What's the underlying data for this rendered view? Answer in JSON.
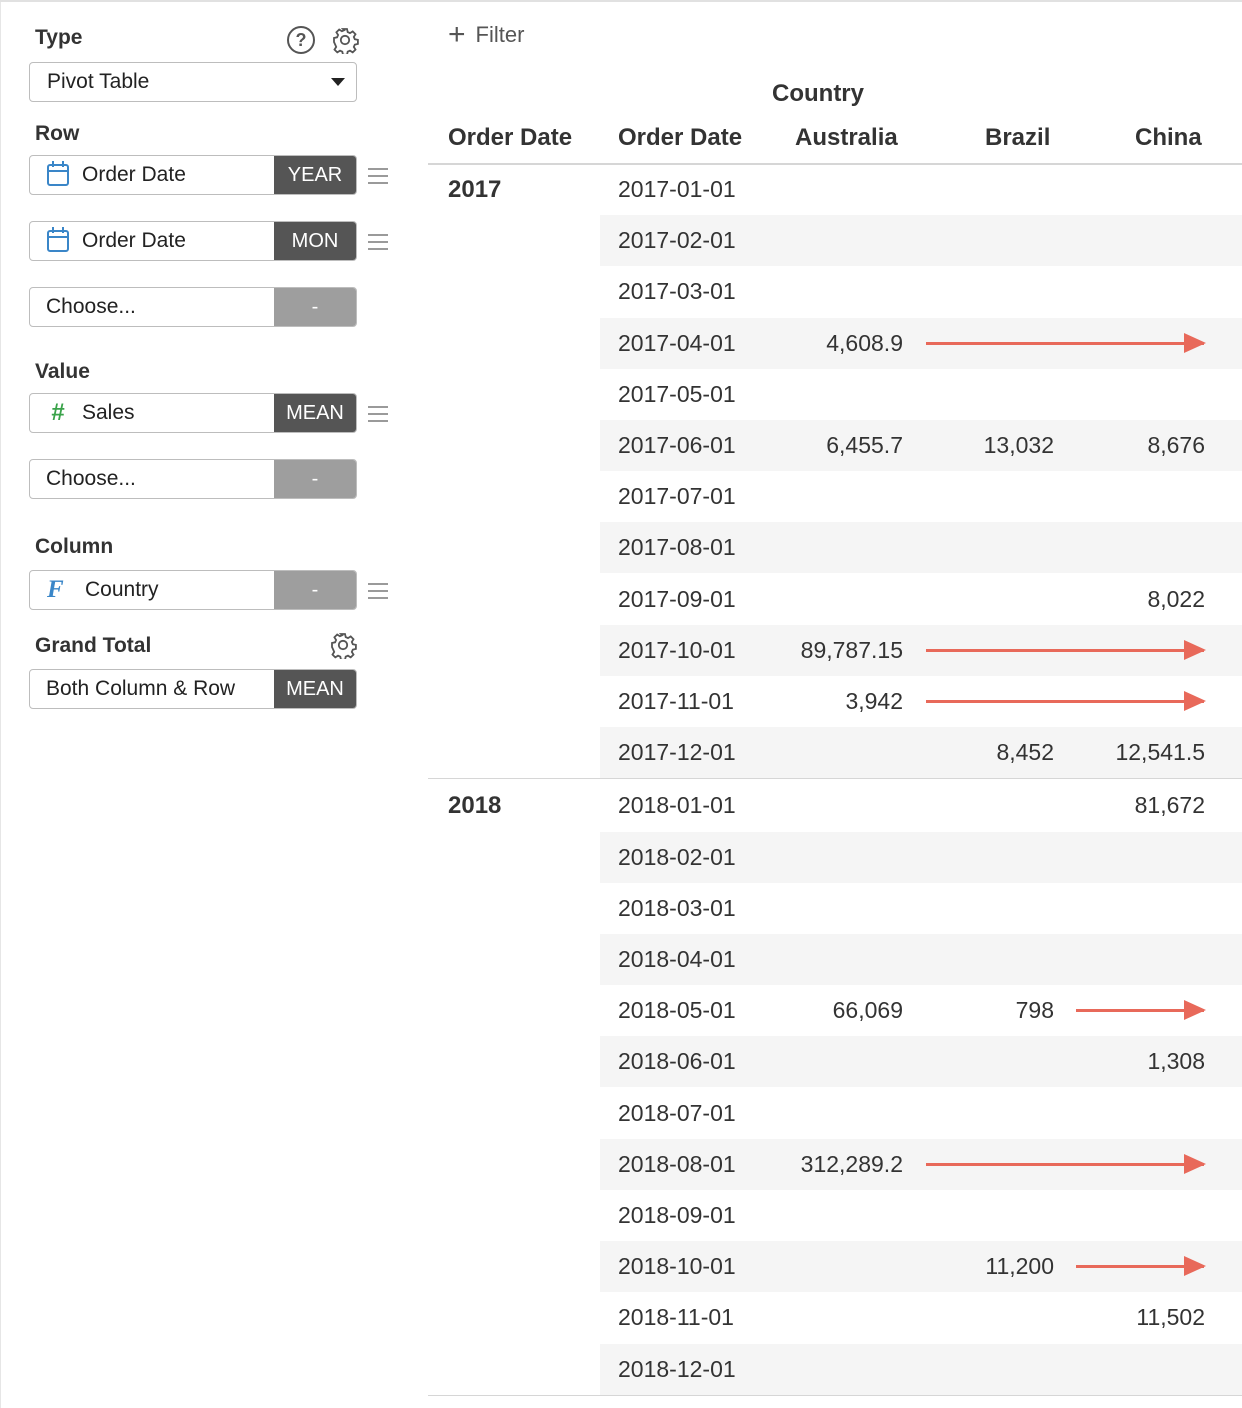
{
  "sidebar": {
    "type_label": "Type",
    "chart_type": "Pivot Table",
    "row_label": "Row",
    "row_fields": [
      {
        "name": "Order Date",
        "agg": "YEAR",
        "icon": "calendar-icon"
      },
      {
        "name": "Order Date",
        "agg": "MON",
        "icon": "calendar-icon"
      },
      {
        "name": "Choose...",
        "agg": "-"
      }
    ],
    "value_label": "Value",
    "value_fields": [
      {
        "name": "Sales",
        "agg": "MEAN",
        "icon": "hash-icon",
        "icon_glyph": "#"
      },
      {
        "name": "Choose...",
        "agg": "-"
      }
    ],
    "column_label": "Column",
    "column_field": {
      "name": "Country",
      "agg": "-",
      "icon": "function-icon",
      "icon_glyph": "F"
    },
    "grand_total_label": "Grand Total",
    "grand_total": {
      "name": "Both Column & Row",
      "agg": "MEAN"
    }
  },
  "toolbar": {
    "filter_label": "Filter",
    "filter_glyph": "+",
    "help_glyph": "?"
  },
  "table": {
    "column_group": "Country",
    "headers": [
      "Order Date",
      "Order Date",
      "Australia",
      "Brazil",
      "China"
    ],
    "arrow_color": "#e8695a",
    "groups": [
      {
        "year": "2017",
        "rows": [
          {
            "date": "2017-01-01",
            "australia": "",
            "brazil": "",
            "china": ""
          },
          {
            "date": "2017-02-01",
            "australia": "",
            "brazil": "",
            "china": ""
          },
          {
            "date": "2017-03-01",
            "australia": "",
            "brazil": "",
            "china": ""
          },
          {
            "date": "2017-04-01",
            "australia": "4,608.9",
            "brazil": "",
            "china": ""
          },
          {
            "date": "2017-05-01",
            "australia": "",
            "brazil": "",
            "china": ""
          },
          {
            "date": "2017-06-01",
            "australia": "6,455.7",
            "brazil": "13,032",
            "china": "8,676"
          },
          {
            "date": "2017-07-01",
            "australia": "",
            "brazil": "",
            "china": ""
          },
          {
            "date": "2017-08-01",
            "australia": "",
            "brazil": "",
            "china": ""
          },
          {
            "date": "2017-09-01",
            "australia": "",
            "brazil": "",
            "china": "8,022"
          },
          {
            "date": "2017-10-01",
            "australia": "89,787.15",
            "brazil": "",
            "china": ""
          },
          {
            "date": "2017-11-01",
            "australia": "3,942",
            "brazil": "",
            "china": ""
          },
          {
            "date": "2017-12-01",
            "australia": "",
            "brazil": "8,452",
            "china": "12,541.5"
          }
        ]
      },
      {
        "year": "2018",
        "rows": [
          {
            "date": "2018-01-01",
            "australia": "",
            "brazil": "",
            "china": "81,672"
          },
          {
            "date": "2018-02-01",
            "australia": "",
            "brazil": "",
            "china": ""
          },
          {
            "date": "2018-03-01",
            "australia": "",
            "brazil": "",
            "china": ""
          },
          {
            "date": "2018-04-01",
            "australia": "",
            "brazil": "",
            "china": ""
          },
          {
            "date": "2018-05-01",
            "australia": "66,069",
            "brazil": "798",
            "china": ""
          },
          {
            "date": "2018-06-01",
            "australia": "",
            "brazil": "",
            "china": "1,308"
          },
          {
            "date": "2018-07-01",
            "australia": "",
            "brazil": "",
            "china": ""
          },
          {
            "date": "2018-08-01",
            "australia": "312,289.2",
            "brazil": "",
            "china": ""
          },
          {
            "date": "2018-09-01",
            "australia": "",
            "brazil": "",
            "china": ""
          },
          {
            "date": "2018-10-01",
            "australia": "",
            "brazil": "11,200",
            "china": ""
          },
          {
            "date": "2018-11-01",
            "australia": "",
            "brazil": "",
            "china": "11,502"
          },
          {
            "date": "2018-12-01",
            "australia": "",
            "brazil": "",
            "china": ""
          }
        ]
      }
    ]
  }
}
